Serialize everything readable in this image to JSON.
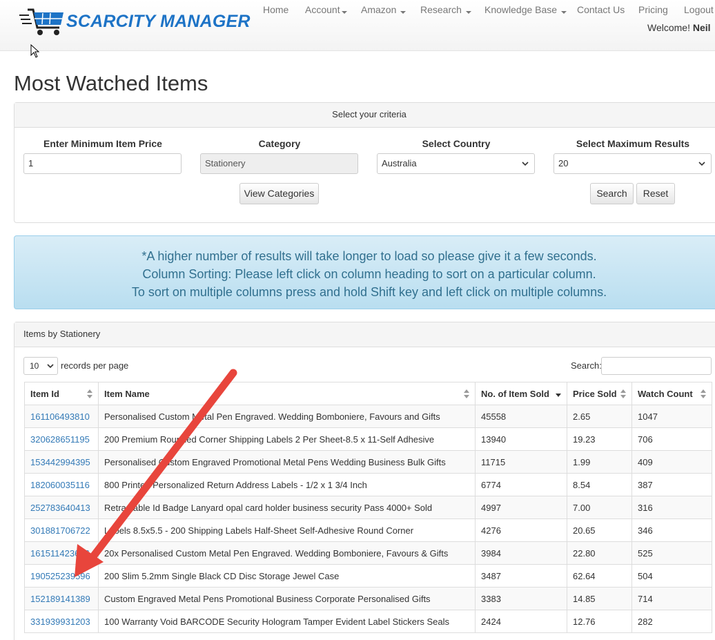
{
  "brand": {
    "name": "SCARCITY MANAGER",
    "logo_icon": "shopping-cart-icon",
    "color": "#1d73c6"
  },
  "nav": {
    "home": "Home",
    "account": "Account",
    "amazon": "Amazon",
    "research": "Research",
    "knowledge_base": "Knowledge Base",
    "contact": "Contact Us",
    "pricing": "Pricing",
    "logout": "Logout",
    "welcome_prefix": "Welcome!",
    "user": "Neil"
  },
  "page": {
    "title": "Most Watched Items"
  },
  "criteria": {
    "heading": "Select your criteria",
    "min_price_label": "Enter Minimum Item Price",
    "min_price_value": "1",
    "category_label": "Category",
    "category_value": "Stationery",
    "country_label": "Select Country",
    "country_value": "Australia",
    "max_results_label": "Select Maximum Results",
    "max_results_value": "20",
    "view_categories": "View Categories",
    "search": "Search",
    "reset": "Reset"
  },
  "info": {
    "line1": "*A higher number of results will take longer to load so please give it a few seconds.",
    "line2": "Column Sorting: Please left click on column heading to sort on a particular column.",
    "line3": "To sort on multiple columns press and hold Shift key and left click on multiple columns.",
    "color": "#31708f"
  },
  "items_panel": {
    "heading": "Items by Stationery",
    "length_value": "10",
    "length_label": "records per page",
    "search_label": "Search:",
    "columns": [
      "Item Id",
      "Item Name",
      "No. of Item Sold",
      "Price Sold",
      "Watch Count"
    ],
    "rows": [
      [
        "161106493810",
        "Personalised Custom Metal Pen Engraved. Wedding Bomboniere, Favours and Gifts",
        "45558",
        "2.65",
        "1047"
      ],
      [
        "320628651195",
        "200 Premium Rounded Corner Shipping Labels 2 Per Sheet-8.5 x 11-Self Adhesive",
        "13940",
        "19.23",
        "706"
      ],
      [
        "153442994395",
        "Personalised Custom Engraved Promotional Metal Pens Wedding Business Bulk Gifts",
        "11715",
        "1.99",
        "409"
      ],
      [
        "182060035116",
        "800 Printed Personalized Return Address Labels - 1/2 x 1 3/4 Inch",
        "6774",
        "8.54",
        "387"
      ],
      [
        "252783640413",
        "Retractable Id Badge Lanyard opal card holder business security Pass 4000+ Sold",
        "4997",
        "7.00",
        "316"
      ],
      [
        "301881706722",
        "Labels 8.5x5.5 - 200 Shipping Labels Half-Sheet Self-Adhesive Round Corner",
        "4276",
        "20.65",
        "346"
      ],
      [
        "161511423616",
        "20x Personalised Custom Metal Pen Engraved. Wedding Bomboniere, Favours & Gifts",
        "3984",
        "22.80",
        "525"
      ],
      [
        "190525239596",
        "200 Slim 5.2mm Single Black CD Disc Storage Jewel Case",
        "3487",
        "62.64",
        "504"
      ],
      [
        "152189141389",
        "Custom Engraved Metal Pens Promotional Business Corporate Personalised Gifts",
        "3383",
        "14.85",
        "714"
      ],
      [
        "331939931203",
        "100 Warranty Void BARCODE Security Hologram Tamper Evident Label Stickers Seals",
        "2424",
        "12.76",
        "282"
      ]
    ],
    "link_color": "#337ab7"
  },
  "annotation": {
    "arrow_color": "#e8453c"
  }
}
